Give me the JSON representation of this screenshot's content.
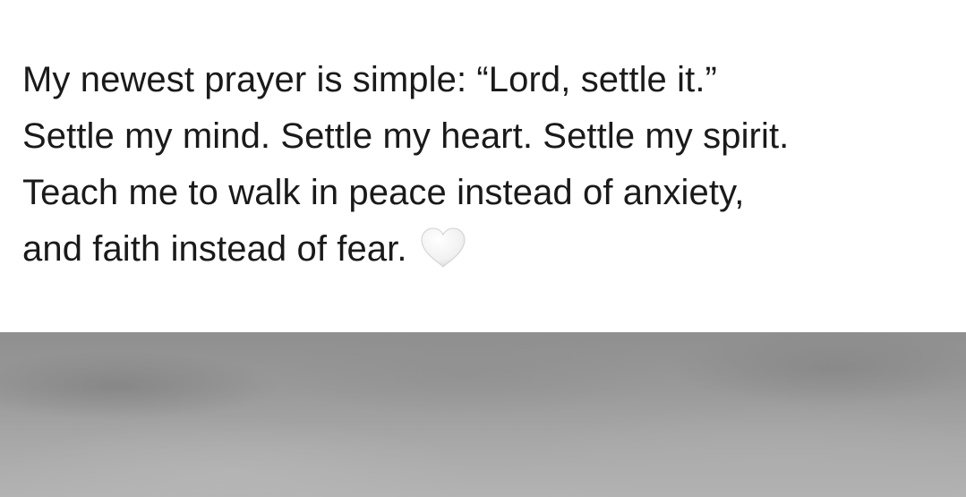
{
  "post": {
    "lines": [
      "My newest prayer is simple: “Lord, settle it.”",
      "Settle my mind. Settle my heart. Settle my spirit.",
      "Teach me to walk in peace instead of anxiety,",
      "and faith instead of fear."
    ],
    "trailing_emoji": "white-heart-icon"
  },
  "colors": {
    "text": "#1a1a1a",
    "background": "#ffffff",
    "heart": "#f4f4f4",
    "media_placeholder": "#9a9a9a"
  }
}
